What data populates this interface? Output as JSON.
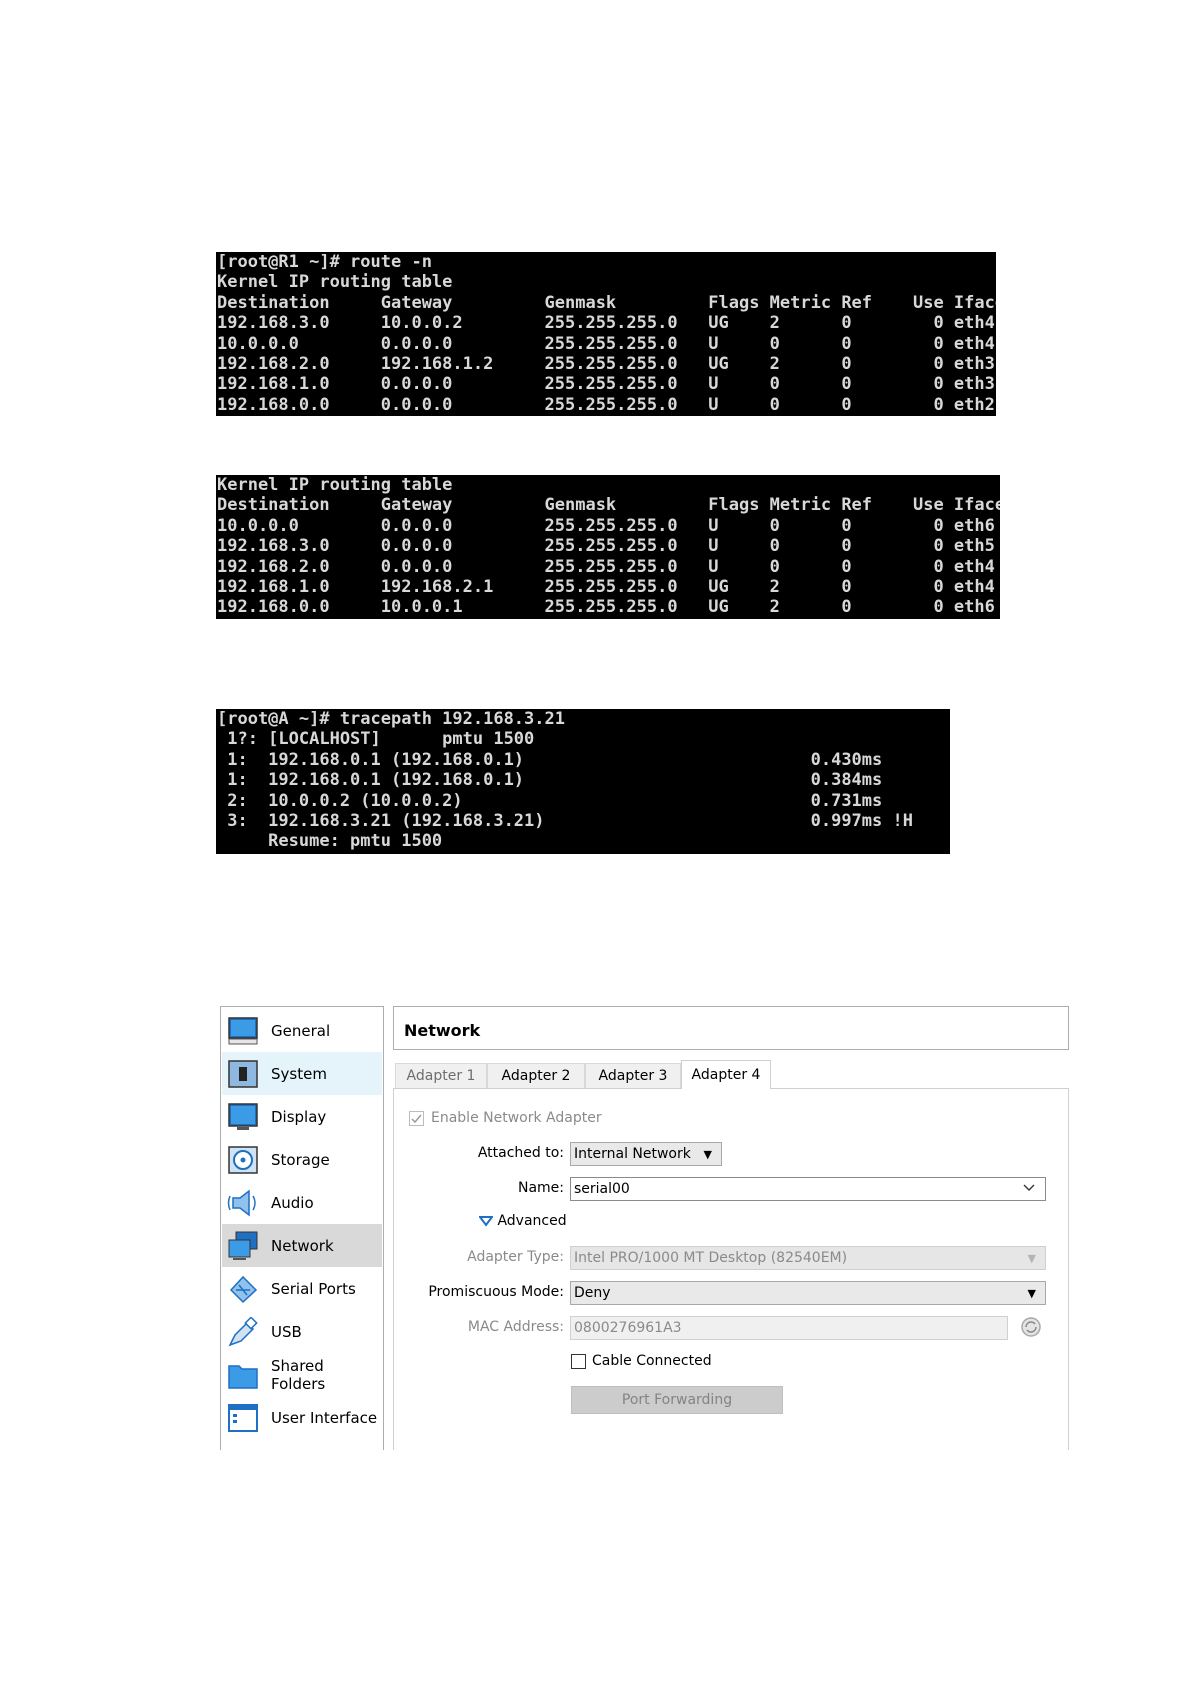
{
  "terminal1": {
    "lines": [
      "[root@R1 ~]# route -n",
      "Kernel IP routing table",
      "Destination     Gateway         Genmask         Flags Metric Ref    Use Iface",
      "192.168.3.0     10.0.0.2        255.255.255.0   UG    2      0        0 eth4",
      "10.0.0.0        0.0.0.0         255.255.255.0   U     0      0        0 eth4",
      "192.168.2.0     192.168.1.2     255.255.255.0   UG    2      0        0 eth3",
      "192.168.1.0     0.0.0.0         255.255.255.0   U     0      0        0 eth3",
      "192.168.0.0     0.0.0.0         255.255.255.0   U     0      0        0 eth2"
    ]
  },
  "terminal2": {
    "lines": [
      "Kernel IP routing table",
      "Destination     Gateway         Genmask         Flags Metric Ref    Use Iface",
      "10.0.0.0        0.0.0.0         255.255.255.0   U     0      0        0 eth6",
      "192.168.3.0     0.0.0.0         255.255.255.0   U     0      0        0 eth5",
      "192.168.2.0     0.0.0.0         255.255.255.0   U     0      0        0 eth4",
      "192.168.1.0     192.168.2.1     255.255.255.0   UG    2      0        0 eth4",
      "192.168.0.0     10.0.0.1        255.255.255.0   UG    2      0        0 eth6"
    ]
  },
  "terminal3": {
    "lines": [
      "[root@A ~]# tracepath 192.168.3.21",
      " 1?: [LOCALHOST]      pmtu 1500",
      " 1:  192.168.0.1 (192.168.0.1)                            0.430ms",
      " 1:  192.168.0.1 (192.168.0.1)                            0.384ms",
      " 2:  10.0.0.2 (10.0.0.2)                                  0.731ms",
      " 3:  192.168.3.21 (192.168.3.21)                          0.997ms !H",
      "     Resume: pmtu 1500"
    ]
  },
  "sidebar": {
    "items": [
      {
        "label": "General",
        "icon": "monitor-icon"
      },
      {
        "label": "System",
        "icon": "chip-icon"
      },
      {
        "label": "Display",
        "icon": "display-icon"
      },
      {
        "label": "Storage",
        "icon": "disc-icon"
      },
      {
        "label": "Audio",
        "icon": "speaker-icon"
      },
      {
        "label": "Network",
        "icon": "network-icon"
      },
      {
        "label": "Serial Ports",
        "icon": "serial-port-icon"
      },
      {
        "label": "USB",
        "icon": "usb-icon"
      },
      {
        "label": "Shared Folders",
        "icon": "folder-icon"
      },
      {
        "label": "User Interface",
        "icon": "window-icon"
      }
    ]
  },
  "panel": {
    "title": "Network",
    "tabs": [
      "Adapter 1",
      "Adapter 2",
      "Adapter 3",
      "Adapter 4"
    ],
    "enable_label": "Enable Network Adapter",
    "attached_label": "Attached to:",
    "attached_value": "Internal Network",
    "name_label": "Name:",
    "name_value": "serial00",
    "advanced_label": "Advanced",
    "adapter_type_label": "Adapter Type:",
    "adapter_type_value": "Intel PRO/1000 MT Desktop (82540EM)",
    "promiscuous_label": "Promiscuous Mode:",
    "promiscuous_value": "Deny",
    "mac_label": "MAC Address:",
    "mac_value": "0800276961A3",
    "cable_label": "Cable Connected",
    "port_forwarding_label": "Port Forwarding"
  }
}
